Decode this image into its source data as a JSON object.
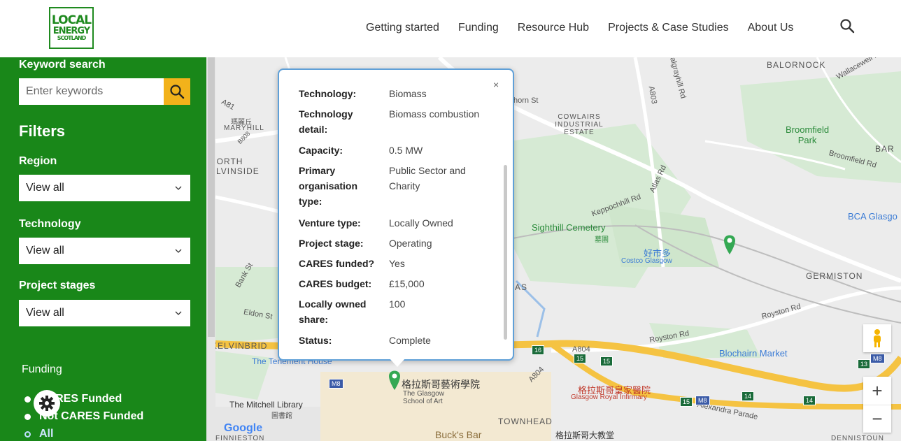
{
  "header": {
    "logo": {
      "line1": "LOCAL",
      "line2": "ENERGY",
      "line3": "SCOTLAND"
    },
    "nav": [
      "Getting started",
      "Funding",
      "Resource Hub",
      "Projects & Case Studies",
      "About Us"
    ]
  },
  "sidebar": {
    "keyword_label": "Keyword search",
    "keyword_placeholder": "Enter keywords",
    "filters_title": "Filters",
    "region_label": "Region",
    "region_value": "View all",
    "technology_label": "Technology",
    "technology_value": "View all",
    "stages_label": "Project stages",
    "stages_value": "View all",
    "funding_label": "Funding",
    "funding_options": [
      "CARES Funded",
      "Not CARES Funded",
      "All"
    ]
  },
  "popup": {
    "close": "×",
    "rows": [
      {
        "k": "Technology:",
        "v": "Biomass"
      },
      {
        "k": "Technology detail:",
        "v": "Biomass combustion"
      },
      {
        "k": "Capacity:",
        "v": "0.5 MW"
      },
      {
        "k": "Primary organisation type:",
        "v": "Public Sector and Charity"
      },
      {
        "k": "Venture type:",
        "v": "Locally Owned"
      },
      {
        "k": "Project stage:",
        "v": "Operating"
      },
      {
        "k": "CARES funded?",
        "v": "Yes"
      },
      {
        "k": "CARES budget:",
        "v": "£15,000"
      },
      {
        "k": "Locally owned share:",
        "v": "100"
      },
      {
        "k": "Status:",
        "v": "Complete"
      }
    ]
  },
  "map": {
    "labels": {
      "balornock": "BALORNOCK",
      "cowlairs": "COWLAIRS\nINDUSTRIAL\nESTATE",
      "broomfield_park": "Broomfield\nPark",
      "bar": "BAR",
      "maryhill_cn": "瑪麗丘",
      "maryhill": "MARYHILL",
      "north_kelvinside": "NORTH\nELVINSIDE",
      "bca": "BCA Glasgo",
      "sighthill": "Sighthill Cemetery",
      "sighthill_cn": "墓園",
      "costco_cn": "好市多",
      "costco": "Costco Glasgow",
      "germiston": "GERMISTON",
      "kelvinbridge": "KELVINBRID",
      "tenement": "The Tenement House",
      "blochairn": "Blochairn Market",
      "gsa_cn": "格拉斯哥藝術學院",
      "gsa": "The Glasgow\nSchool of Art",
      "gri_cn": "格拉斯哥皇家醫院",
      "gri": "Glasgow Royal Infirmary",
      "mitchell": "The Mitchell Library",
      "mitchell_cn": "圖書館",
      "townhead": "TOWNHEAD",
      "bucks": "Buck's Bar",
      "cathedral_cn": "格拉斯哥大教堂",
      "dennistoun": "DENNISTOUN",
      "finnieston": "FINNIESTON",
      "royston_rd": "Royston Rd",
      "alexandra": "Alexandra Parade",
      "keppochhill": "Keppochhill Rd",
      "as": "AS",
      "horn_st": "horn St",
      "eldon": "Eldon St",
      "bank_st": "Bank St",
      "a804": "A804",
      "a803": "A803",
      "a81": "A81",
      "b808": "B808",
      "balgrayhill": "Balgrayhill Rd",
      "broomfield_rd": "Broomfield Rd",
      "atlas_rd": "Atlas Rd",
      "wallacewell": "Wallacewell R"
    },
    "badges": [
      "M8",
      "16",
      "15",
      "15",
      "M8",
      "14",
      "14",
      "13",
      "M8",
      "15"
    ],
    "attribution": "Google"
  },
  "colors": {
    "sidebar": "#198719",
    "accent": "#f2b21b",
    "popup_border": "#5fa0d8"
  }
}
